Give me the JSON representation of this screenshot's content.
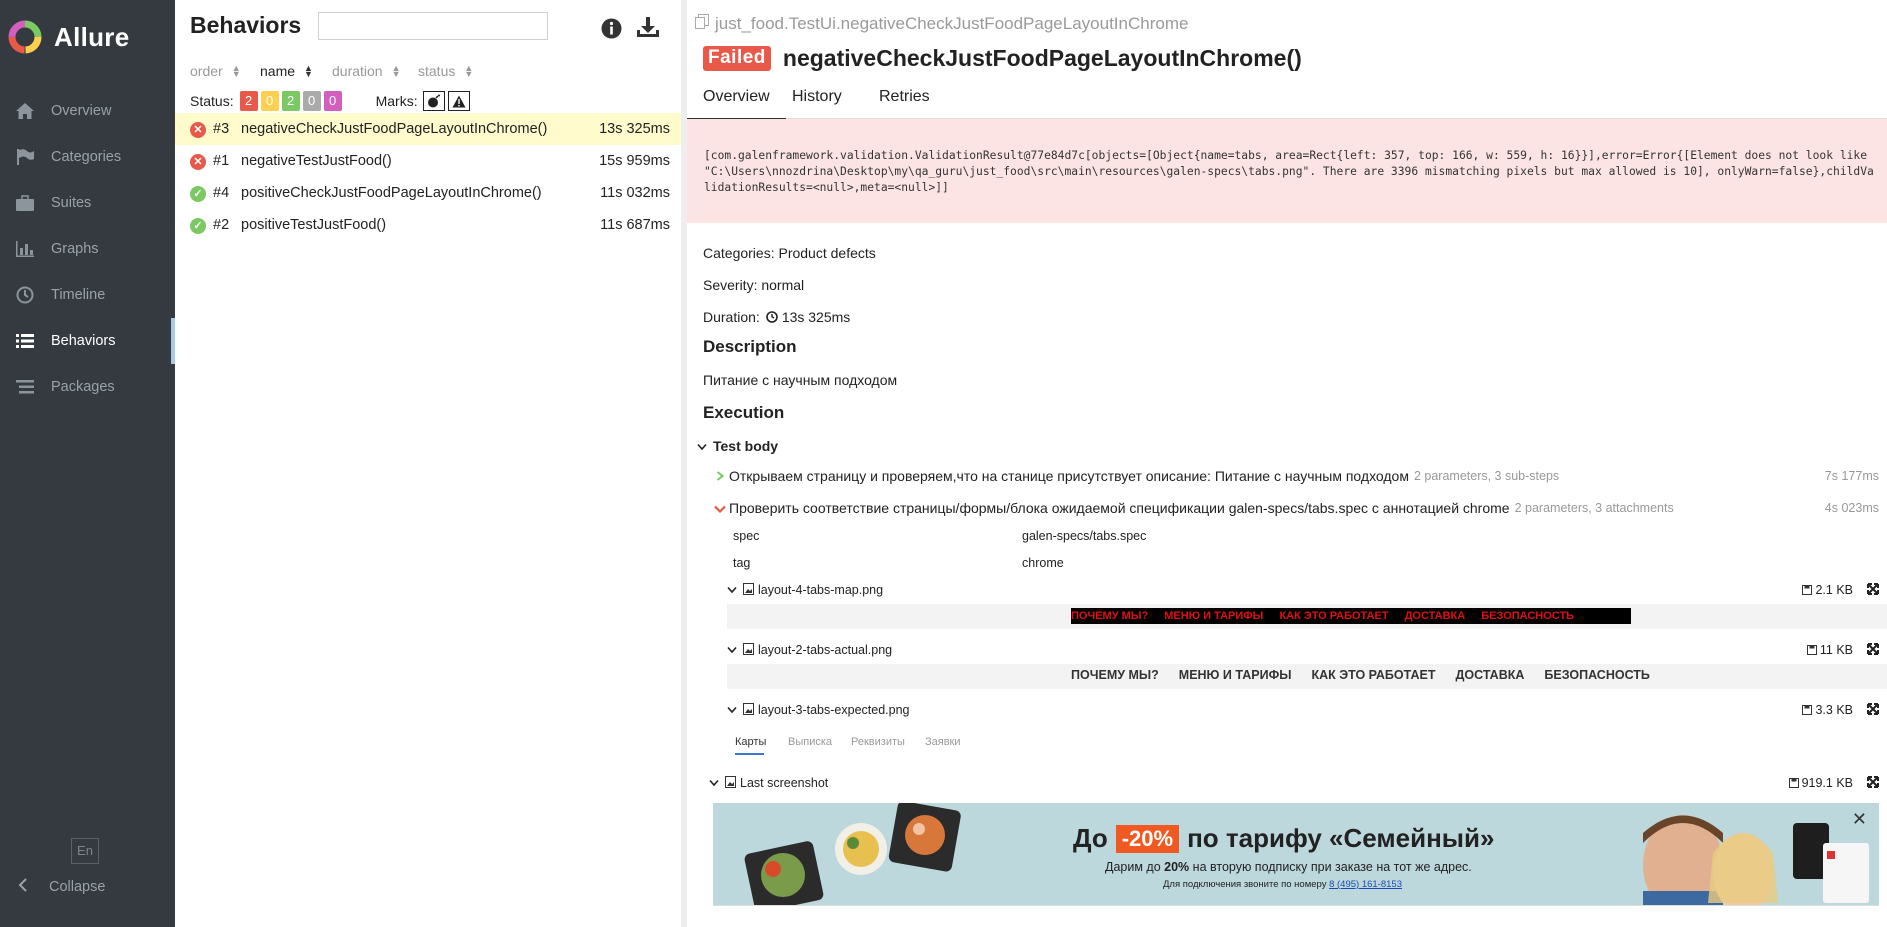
{
  "app": {
    "name": "Allure"
  },
  "sidebar": {
    "items": [
      {
        "label": "Overview",
        "icon": "home-icon"
      },
      {
        "label": "Categories",
        "icon": "flag-icon"
      },
      {
        "label": "Suites",
        "icon": "briefcase-icon"
      },
      {
        "label": "Graphs",
        "icon": "bar-chart-icon"
      },
      {
        "label": "Timeline",
        "icon": "clock-icon"
      },
      {
        "label": "Behaviors",
        "icon": "list-icon",
        "active": true
      },
      {
        "label": "Packages",
        "icon": "packages-icon"
      }
    ],
    "lang": "En",
    "collapse": "Collapse"
  },
  "tree": {
    "title": "Behaviors",
    "search_placeholder": "",
    "sort": {
      "order": "order",
      "name": "name",
      "duration": "duration",
      "status": "status"
    },
    "status_label": "Status:",
    "status_counts": {
      "failed": "2",
      "broken": "0",
      "passed": "2",
      "skipped": "0",
      "unknown": "0"
    },
    "marks_label": "Marks:",
    "rows": [
      {
        "num": "#3",
        "name": "negativeCheckJustFoodPageLayoutInChrome()",
        "duration": "13s 325ms",
        "status": "failed"
      },
      {
        "num": "#1",
        "name": "negativeTestJustFood()",
        "duration": "15s 959ms",
        "status": "failed"
      },
      {
        "num": "#4",
        "name": "positiveCheckJustFoodPageLayoutInChrome()",
        "duration": "11s 032ms",
        "status": "passed"
      },
      {
        "num": "#2",
        "name": "positiveTestJustFood()",
        "duration": "11s 687ms",
        "status": "passed"
      }
    ]
  },
  "testcase": {
    "breadcrumb": "just_food.TestUi.negativeCheckJustFoodPageLayoutInChrome",
    "status": "Failed",
    "title": "negativeCheckJustFoodPageLayoutInChrome()",
    "tabs": [
      "Overview",
      "History",
      "Retries"
    ],
    "error": "[com.galenframework.validation.ValidationResult@77e84d7c[objects=[Object{name=tabs, area=Rect{left: 357, top: 166, w: 559, h: 16}}],error=Error{[Element does not look like \"C:\\Users\\nnozdrina\\Desktop\\my\\qa_guru\\just_food\\src\\main\\resources\\galen-specs\\tabs.png\". There are 3396 mismatching pixels but max allowed is 10], onlyWarn=false},childValidationResults=<null>,meta=<null>]]",
    "categories": "Categories: Product defects",
    "severity": "Severity: normal",
    "duration_label": "Duration:",
    "duration": "13s 325ms",
    "description_heading": "Description",
    "description": "Питание с научным подходом",
    "execution_heading": "Execution",
    "test_body": "Test body",
    "steps": [
      {
        "name": "Открываем страницу и проверяем,что на станице присутствует описание: Питание с научным подходом",
        "meta": "2 parameters, 3 sub-steps",
        "time": "7s 177ms",
        "status": "passed"
      },
      {
        "name": "Проверить соответствие страницы/формы/блока ожидаемой спецификации galen-specs/tabs.spec с аннотацией chrome",
        "meta": "2 parameters, 3 attachments",
        "time": "4s 023ms",
        "status": "failed"
      }
    ],
    "params": [
      {
        "name": "spec",
        "value": "galen-specs/tabs.spec"
      },
      {
        "name": "tag",
        "value": "chrome"
      }
    ],
    "attachments": [
      {
        "name": "layout-4-tabs-map.png",
        "size": "2.1 KB"
      },
      {
        "name": "layout-2-tabs-actual.png",
        "size": "11 KB"
      },
      {
        "name": "layout-3-tabs-expected.png",
        "size": "3.3 KB"
      },
      {
        "name": "Last screenshot",
        "size": "919.1 KB"
      }
    ],
    "map_tabs": [
      "ПОЧЕМУ МЫ?",
      "МЕНЮ И ТАРИФЫ",
      "КАК ЭТО РАБОТАЕТ",
      "ДОСТАВКА",
      "БЕЗОПАСНОСТЬ"
    ],
    "actual_tabs": [
      "ПОЧЕМУ МЫ?",
      "МЕНЮ И ТАРИФЫ",
      "КАК ЭТО РАБОТАЕТ",
      "ДОСТАВКА",
      "БЕЗОПАСНОСТЬ"
    ],
    "expected_tabs": [
      "Карты",
      "Выписка",
      "Реквизиты",
      "Заявки"
    ],
    "banner": {
      "pre": "До",
      "pct": "-20%",
      "post": "по тарифу «Семейный»",
      "sub_a": "Дарим до",
      "sub_b": "20%",
      "sub_c": "на вторую подписку при заказе на тот же адрес.",
      "phone_a": "Для подключения звоните по номеру",
      "phone_b": "8 (495) 161-8153"
    }
  },
  "colors": {
    "failed": "#e95949",
    "broken": "#ffd050",
    "passed": "#7bc963",
    "skipped": "#aaaaaa",
    "unknown": "#d35ebe",
    "sidebar": "#343a40",
    "selected_row": "#fffbcc",
    "error_bg": "#fde4e4"
  }
}
